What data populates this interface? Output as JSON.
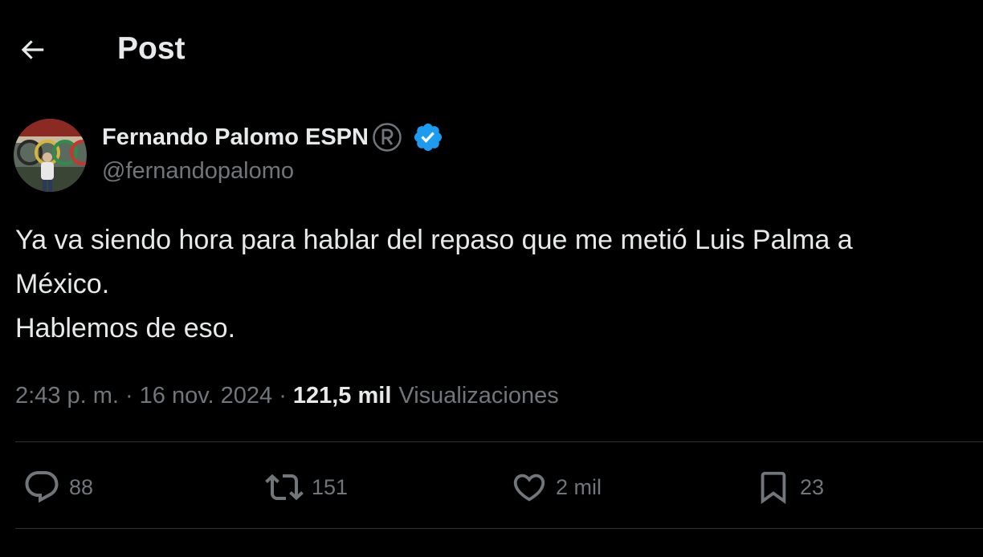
{
  "header": {
    "title": "Post",
    "back_icon": "arrow-left-icon"
  },
  "author": {
    "name": "Fernando Palomo ESPN",
    "handle": "@fernandopalomo",
    "registered_icon": "registered-trademark-icon",
    "verified_icon": "verified-badge-icon",
    "verified_color": "#1d9bf0"
  },
  "tweet": {
    "lines": [
      "Ya va siendo hora para hablar del repaso que me metió Luis Palma a",
      "México.",
      "Hablemos de eso."
    ]
  },
  "meta": {
    "time": "2:43 p. m.",
    "separator": "·",
    "date": "16 nov. 2024",
    "views_count": "121,5 mil",
    "views_label": "Visualizaciones"
  },
  "actions": {
    "reply": {
      "icon": "reply-bubble-icon",
      "count": "88"
    },
    "retweet": {
      "icon": "retweet-icon",
      "count": "151"
    },
    "like": {
      "icon": "heart-icon",
      "count": "2 mil"
    },
    "bookmark": {
      "icon": "bookmark-icon",
      "count": "23"
    }
  },
  "colors": {
    "background": "#000000",
    "primary_text": "#e7e9ea",
    "secondary_text": "#71767b",
    "divider": "#2f3336"
  }
}
